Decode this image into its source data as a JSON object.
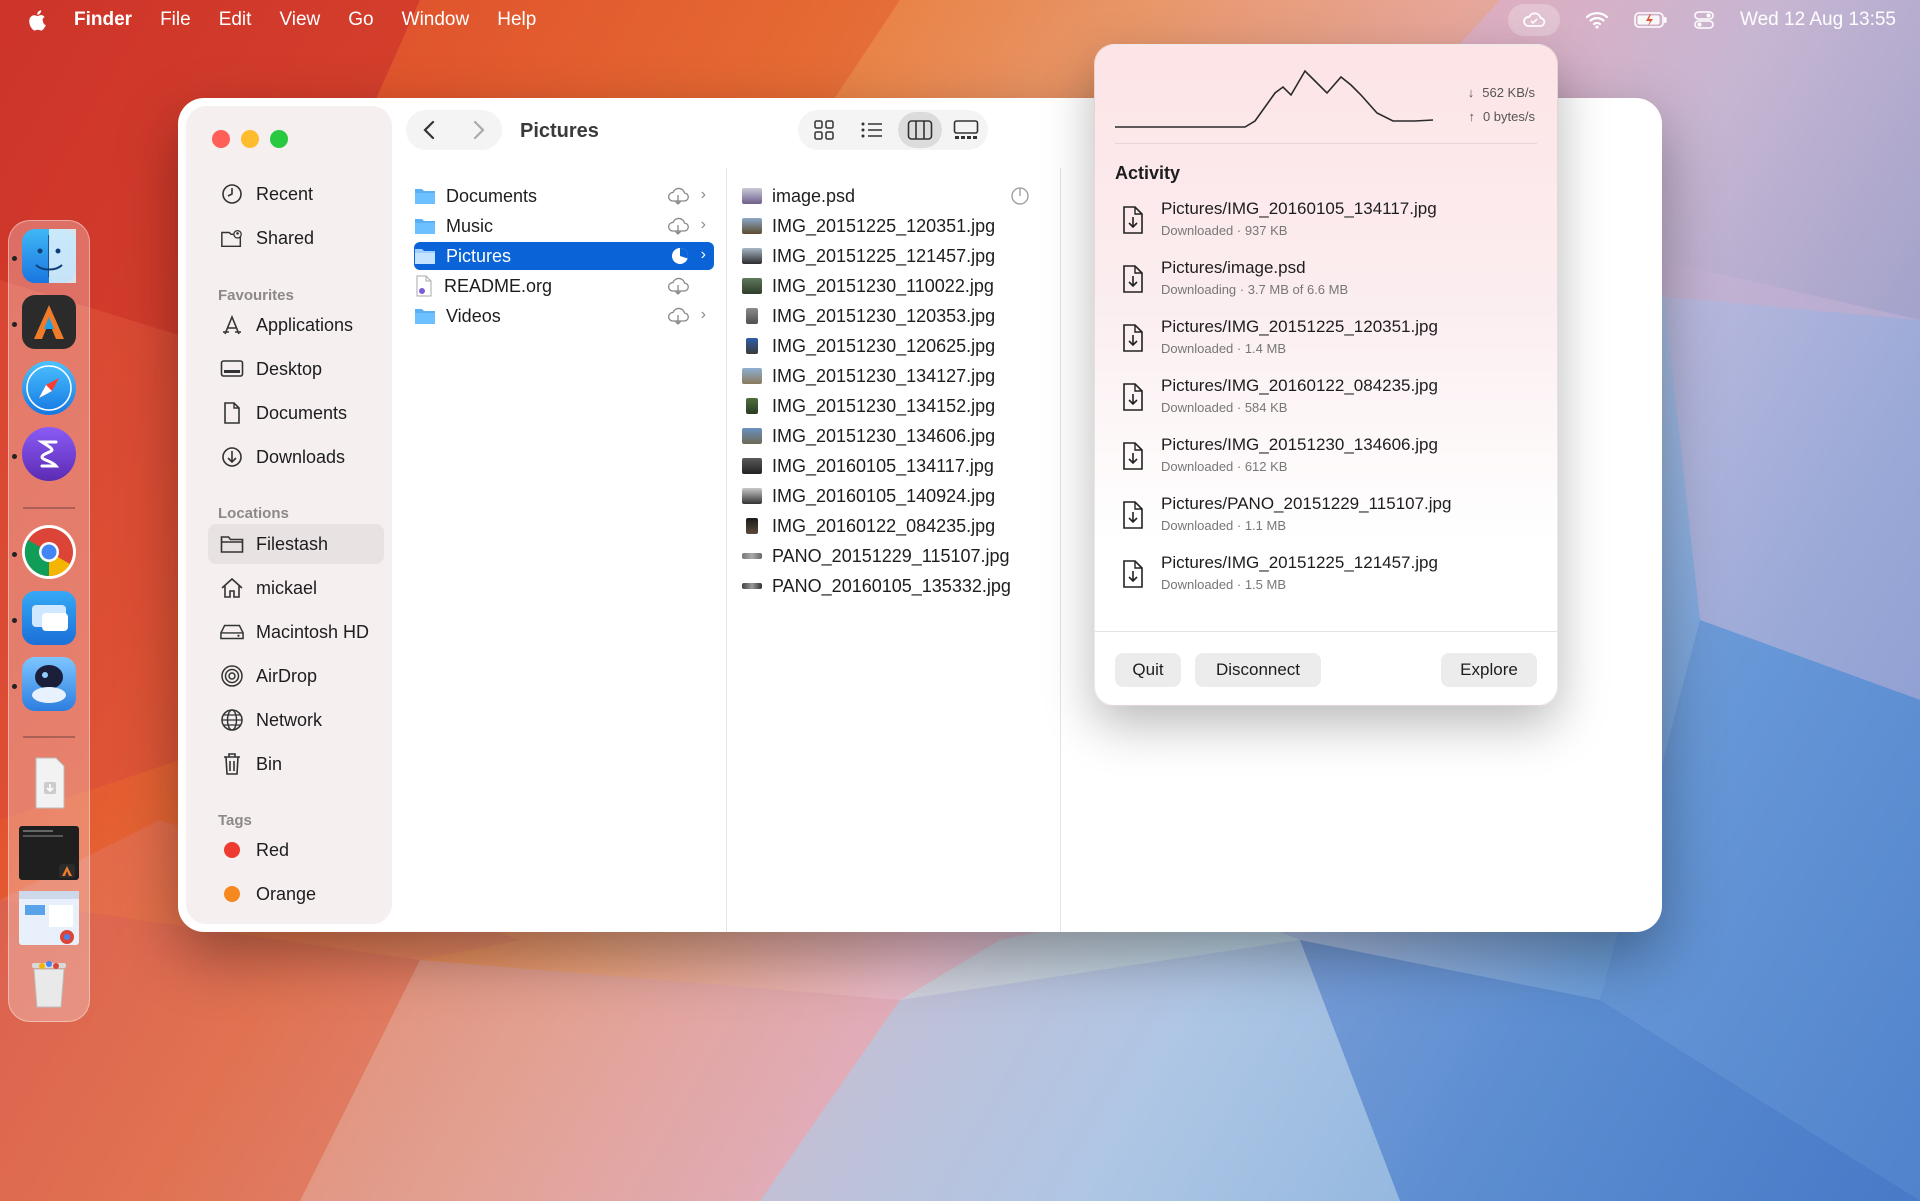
{
  "menubar": {
    "apple": "",
    "app": "Finder",
    "menus": [
      "File",
      "Edit",
      "View",
      "Go",
      "Window",
      "Help"
    ],
    "clock": "Wed 12 Aug  13:55"
  },
  "finder": {
    "title": "Pictures",
    "sidebar": {
      "items_top": [
        "Recent",
        "Shared"
      ],
      "favourites_label": "Favourites",
      "favourites": [
        "Applications",
        "Desktop",
        "Documents",
        "Downloads"
      ],
      "locations_label": "Locations",
      "locations": [
        "Filestash",
        "mickael",
        "Macintosh HD",
        "AirDrop",
        "Network",
        "Bin"
      ],
      "tags_label": "Tags",
      "tags": [
        {
          "label": "Red",
          "color": "#ee3b30"
        },
        {
          "label": "Orange",
          "color": "#f5881f"
        }
      ]
    },
    "column1": [
      "Documents",
      "Music",
      "Pictures",
      "README.org",
      "Videos"
    ],
    "column2": [
      "image.psd",
      "IMG_20151225_120351.jpg",
      "IMG_20151225_121457.jpg",
      "IMG_20151230_110022.jpg",
      "IMG_20151230_120353.jpg",
      "IMG_20151230_120625.jpg",
      "IMG_20151230_134127.jpg",
      "IMG_20151230_134152.jpg",
      "IMG_20151230_134606.jpg",
      "IMG_20160105_134117.jpg",
      "IMG_20160105_140924.jpg",
      "IMG_20160122_084235.jpg",
      "PANO_20151229_115107.jpg",
      "PANO_20160105_135332.jpg"
    ]
  },
  "popover": {
    "download_speed": "562 KB/s",
    "upload_speed": "0 bytes/s",
    "activity_title": "Activity",
    "items": [
      {
        "path": "Pictures/IMG_20160105_134117.jpg",
        "status": "Downloaded · 937 KB"
      },
      {
        "path": "Pictures/image.psd",
        "status": "Downloading · 3.7 MB of 6.6 MB"
      },
      {
        "path": "Pictures/IMG_20151225_120351.jpg",
        "status": "Downloaded · 1.4 MB"
      },
      {
        "path": "Pictures/IMG_20160122_084235.jpg",
        "status": "Downloaded · 584 KB"
      },
      {
        "path": "Pictures/IMG_20151230_134606.jpg",
        "status": "Downloaded · 612 KB"
      },
      {
        "path": "Pictures/PANO_20151229_115107.jpg",
        "status": "Downloaded · 1.1 MB"
      },
      {
        "path": "Pictures/IMG_20151225_121457.jpg",
        "status": "Downloaded · 1.5 MB"
      }
    ],
    "buttons": {
      "quit": "Quit",
      "disconnect": "Disconnect",
      "explore": "Explore"
    }
  },
  "colors": {
    "accent": "#0a64d8",
    "close": "#ff5f57",
    "minimize": "#febc2e",
    "zoom": "#28c840"
  }
}
